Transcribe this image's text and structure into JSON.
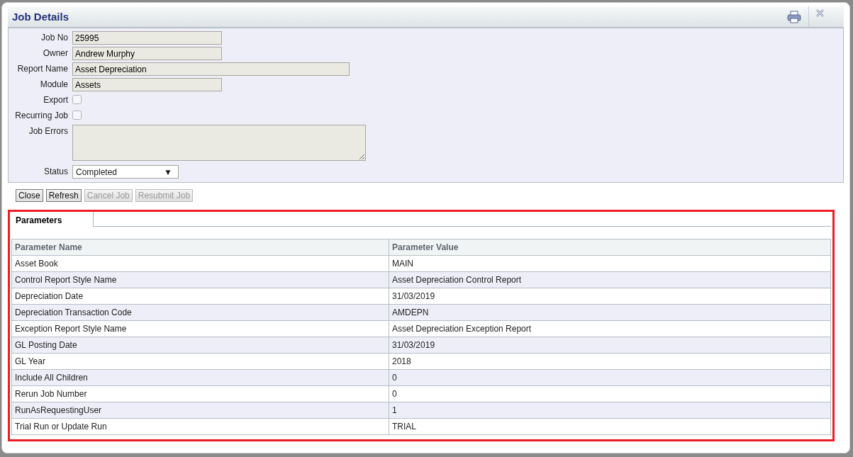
{
  "window": {
    "title": "Job Details"
  },
  "form": {
    "fields": [
      {
        "kind": "text",
        "label": "Job No",
        "value": "25995"
      },
      {
        "kind": "text",
        "label": "Owner",
        "value": "Andrew Murphy"
      },
      {
        "kind": "longtext",
        "label": "Report Name",
        "value": "Asset Depreciation"
      },
      {
        "kind": "text",
        "label": "Module",
        "value": "Assets"
      },
      {
        "kind": "checkbox",
        "label": "Export",
        "checked": false
      },
      {
        "kind": "checkbox",
        "label": "Recurring Job",
        "checked": false
      },
      {
        "kind": "textarea",
        "label": "Job Errors"
      },
      {
        "kind": "select",
        "label": "Status",
        "value": "Completed",
        "arrow": "▼"
      }
    ]
  },
  "buttons": [
    {
      "label": "Close",
      "disabled": false
    },
    {
      "label": "Refresh",
      "disabled": false
    },
    {
      "label": "Cancel Job",
      "disabled": true
    },
    {
      "label": "Resubmit Job",
      "disabled": true
    }
  ],
  "tabs": [
    {
      "label": "Parameters",
      "selected": true
    }
  ],
  "table": {
    "columns": [
      "Parameter Name",
      "Parameter Value"
    ],
    "rows": [
      [
        "Asset Book",
        "MAIN"
      ],
      [
        "Control Report Style Name",
        "Asset Depreciation Control Report"
      ],
      [
        "Depreciation Date",
        "31/03/2019"
      ],
      [
        "Depreciation Transaction Code",
        "AMDEPN"
      ],
      [
        "Exception Report Style Name",
        "Asset Depreciation Exception Report"
      ],
      [
        "GL Posting Date",
        "31/03/2019"
      ],
      [
        "GL Year",
        "2018"
      ],
      [
        "Include All Children",
        "0"
      ],
      [
        "Rerun Job Number",
        "0"
      ],
      [
        "RunAsRequestingUser",
        "1"
      ],
      [
        "Trial Run or Update Run",
        "TRIAL"
      ]
    ]
  }
}
